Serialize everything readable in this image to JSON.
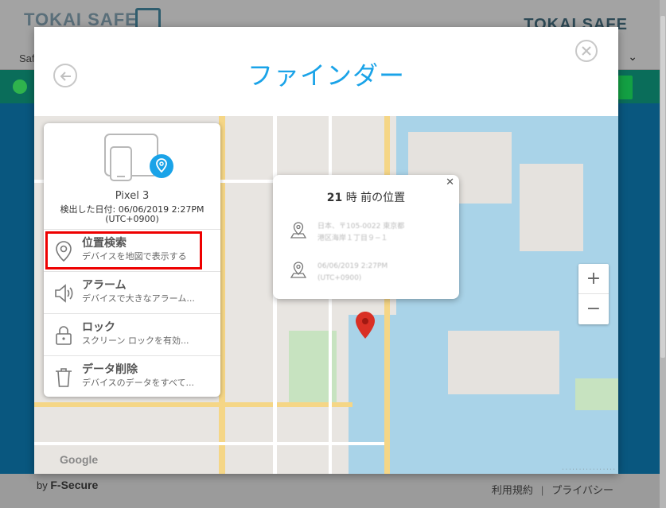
{
  "background": {
    "logo_left": "TOKAI SAFE",
    "logo_right": "TOKAI SAFE",
    "nav_text": "Safe",
    "footer": {
      "by": "by",
      "brand": "F-Secure",
      "links": [
        "利用規約",
        "プライバシー"
      ]
    }
  },
  "modal": {
    "title": "ファインダー"
  },
  "device": {
    "name": "Pixel 3",
    "detected_label": "検出した日付: 06/06/2019 2:27PM",
    "timezone": "(UTC+0900)"
  },
  "menu": [
    {
      "title": "位置検索",
      "subtitle": "デバイスを地図で表示する",
      "icon": "location-icon"
    },
    {
      "title": "アラーム",
      "subtitle": "デバイスで大きなアラーム...",
      "icon": "speaker-icon"
    },
    {
      "title": "ロック",
      "subtitle": "スクリーン ロックを有効...",
      "icon": "lock-icon"
    },
    {
      "title": "データ削除",
      "subtitle": "デバイスのデータをすべて...",
      "icon": "trash-icon"
    }
  ],
  "location_popup": {
    "hours": "21",
    "title_suffix": "時 前の位置",
    "address_line1": "日本、〒105-0022 東京都",
    "address_line2": "港区海岸１丁目９−１",
    "time_line1": "06/06/2019 2:27PM",
    "time_line2": "(UTC+0900)"
  },
  "map": {
    "zoom_in": "+",
    "zoom_out": "−",
    "logo": "Google"
  },
  "colors": {
    "accent": "#1aa3e8",
    "highlight": "#ee0000",
    "pin": "#d93025"
  }
}
